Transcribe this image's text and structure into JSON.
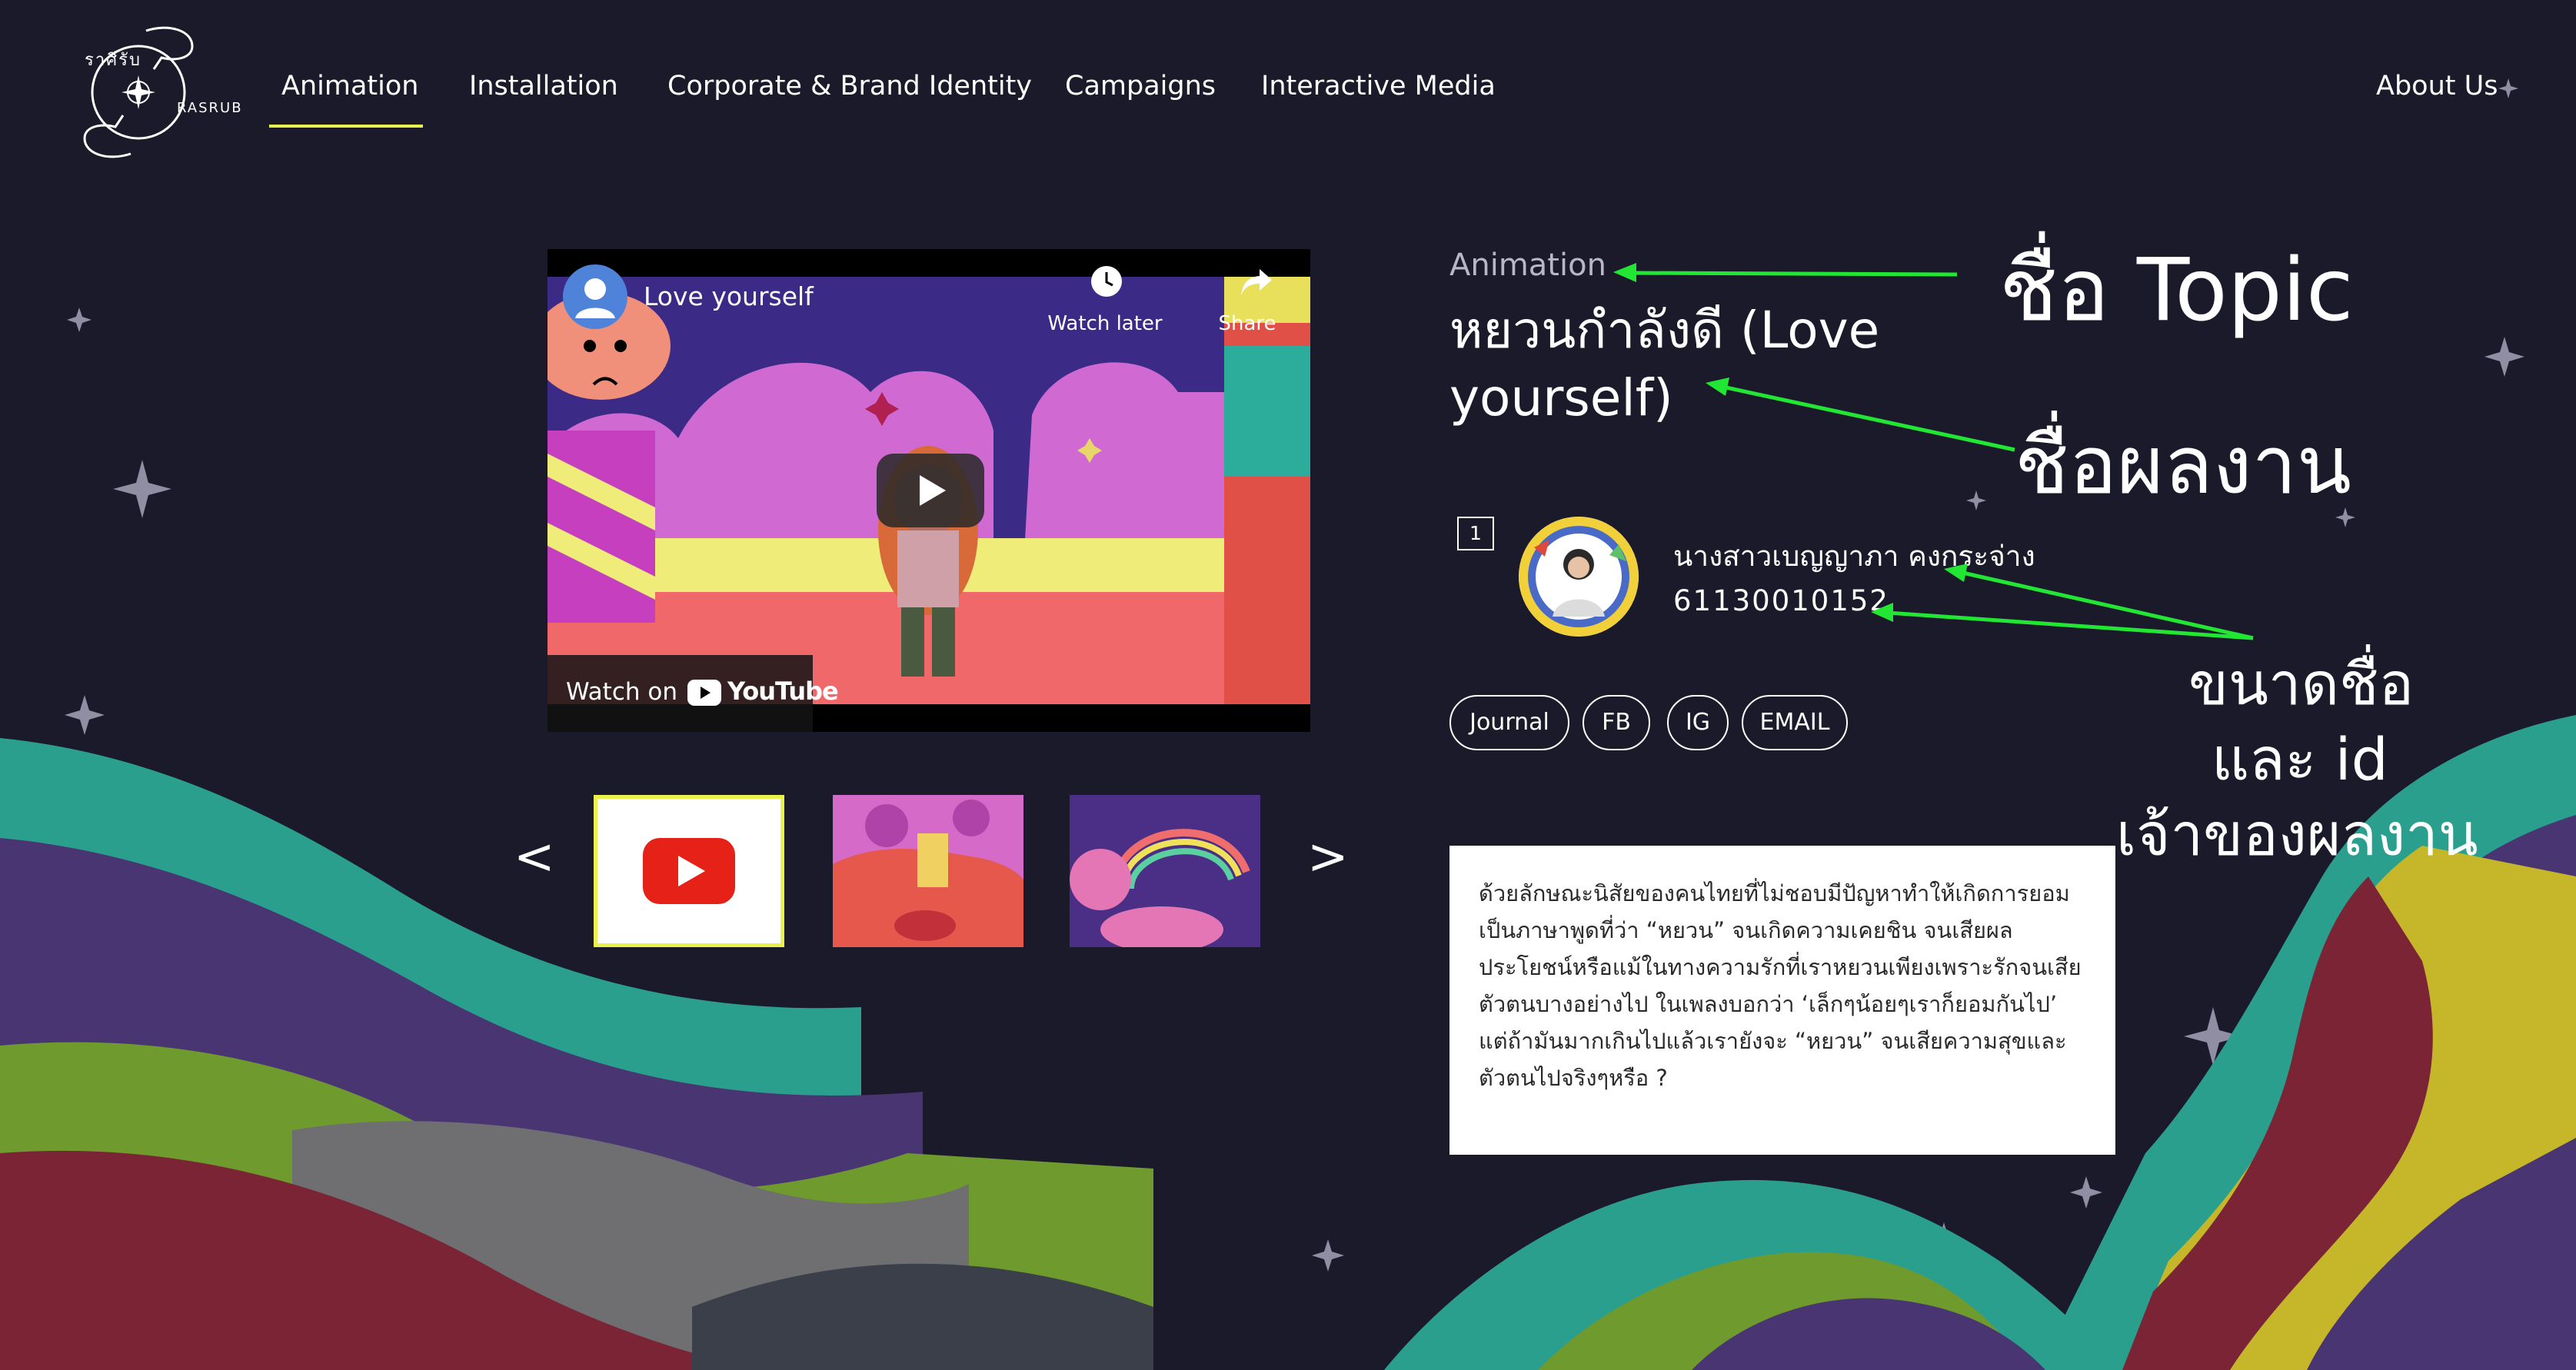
{
  "logo": {
    "arc_text": "ราศีรับ",
    "side_text": "RASRUB"
  },
  "nav": {
    "items": [
      {
        "label": "Animation",
        "active": true
      },
      {
        "label": "Installation"
      },
      {
        "label": "Corporate & Brand Identity"
      },
      {
        "label": "Campaigns"
      },
      {
        "label": "Interactive Media"
      }
    ],
    "about": "About Us",
    "active_underline_color": "#e9f24d"
  },
  "video": {
    "title": "Love yourself",
    "watch_later": "Watch later",
    "share": "Share",
    "watch_on": "Watch on",
    "youtube": "YouTube"
  },
  "gallery": {
    "prev": "<",
    "next": ">",
    "thumbs": [
      "youtube-icon",
      "animation-still-1",
      "animation-still-2"
    ]
  },
  "work": {
    "topic": "Animation",
    "title": "หยวนกำลังดี (Love yourself)",
    "rank": "1",
    "owner_name": "นางสาวเบญญาภา คงกระจ่าง",
    "owner_id": "61130010152",
    "links": [
      "Journal",
      "FB",
      "IG",
      "EMAIL"
    ],
    "description": "ด้วยลักษณะนิสัยของคนไทยที่ไม่ชอบมีปัญหาทำให้เกิดการยอมเป็นภาษาพูดที่ว่า “หยวน” จนเกิดความเคยชิน จนเสียผลประโยชน์หรือแม้ในทางความรักที่เราหยวนเพียงเพราะรักจนเสียตัวตนบางอย่างไป ในเพลงบอกว่า ‘เล็กๆน้อยๆเราก็ยอมกันไป’ แต่ถ้ามันมากเกินไปแล้วเรายังจะ “หยวน” จนเสียความสุขและตัวตนไปจริงๆหรือ ?"
  },
  "annotations": {
    "topic_label": "ชื่อ Topic",
    "work_label": "ชื่อผลงาน",
    "owner_label_1": "ขนาดชื่อ",
    "owner_label_2": "และ id",
    "owner_label_3": "เจ้าของผลงาน",
    "arrow_color": "#22e634"
  }
}
